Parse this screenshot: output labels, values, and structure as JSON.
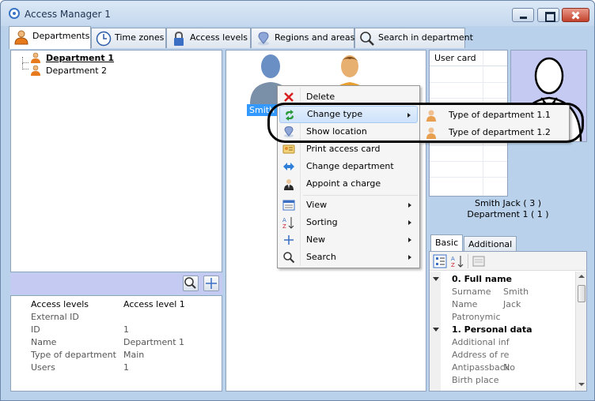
{
  "window": {
    "title": "Access Manager 1"
  },
  "tabs": [
    {
      "label": "Departments",
      "icon": "person-icon"
    },
    {
      "label": "Time zones",
      "icon": "clock-icon"
    },
    {
      "label": "Access levels",
      "icon": "lock-icon"
    },
    {
      "label": "Regions and areas",
      "icon": "pin-icon"
    },
    {
      "label": "Search in department",
      "icon": "search-icon"
    }
  ],
  "tree": {
    "items": [
      {
        "label": "Department 1"
      },
      {
        "label": "Department 2"
      }
    ]
  },
  "department_props": {
    "rows": [
      {
        "key": "Access levels",
        "value": "Access level 1"
      },
      {
        "key": "External ID",
        "value": ""
      },
      {
        "key": "ID",
        "value": "1"
      },
      {
        "key": "Name",
        "value": "Department 1"
      },
      {
        "key": "Type of department",
        "value": "Main"
      },
      {
        "key": "Users",
        "value": "1"
      }
    ]
  },
  "employees": {
    "selected_label": "Smith J"
  },
  "right_panel": {
    "grid_header": "User card",
    "person_name": "Smith Jack ( 3 )",
    "person_dept": "Department 1 ( 1 )",
    "tabs": [
      {
        "label": "Basic"
      },
      {
        "label": "Additional"
      }
    ],
    "categories": [
      {
        "label": "0. Full name",
        "rows": [
          {
            "key": "Surname",
            "value": "Smith"
          },
          {
            "key": "Name",
            "value": "Jack"
          },
          {
            "key": "Patronymic",
            "value": ""
          }
        ]
      },
      {
        "label": "1. Personal data",
        "rows": [
          {
            "key": "Additional inf",
            "value": ""
          },
          {
            "key": "Address of re",
            "value": ""
          },
          {
            "key": "Antipassback",
            "value": "No"
          },
          {
            "key": "Birth place",
            "value": ""
          }
        ]
      }
    ]
  },
  "context_menu": {
    "items": [
      {
        "label": "Delete",
        "icon": "delete-icon"
      },
      {
        "label": "Change type",
        "icon": "change-type-icon",
        "submenu": true,
        "highlighted": true
      },
      {
        "label": "Show location",
        "icon": "location-icon"
      },
      {
        "label": "Print access card",
        "icon": "card-icon"
      },
      {
        "label": "Change department",
        "icon": "arrows-icon"
      },
      {
        "label": "Appoint a charge",
        "icon": "charge-icon"
      },
      {
        "label": "View",
        "icon": "view-icon",
        "submenu": true
      },
      {
        "label": "Sorting",
        "icon": "sort-icon",
        "submenu": true
      },
      {
        "label": "New",
        "icon": "plus-icon",
        "submenu": true
      },
      {
        "label": "Search",
        "icon": "search-icon",
        "submenu": true
      }
    ]
  },
  "submenu": {
    "items": [
      {
        "label": "Type of department 1.1"
      },
      {
        "label": "Type of department 1.2"
      }
    ]
  },
  "colors": {
    "accent": "#3399ff",
    "panel_bg": "#b9d1ea",
    "toolbar_bg": "#c4caf2"
  }
}
